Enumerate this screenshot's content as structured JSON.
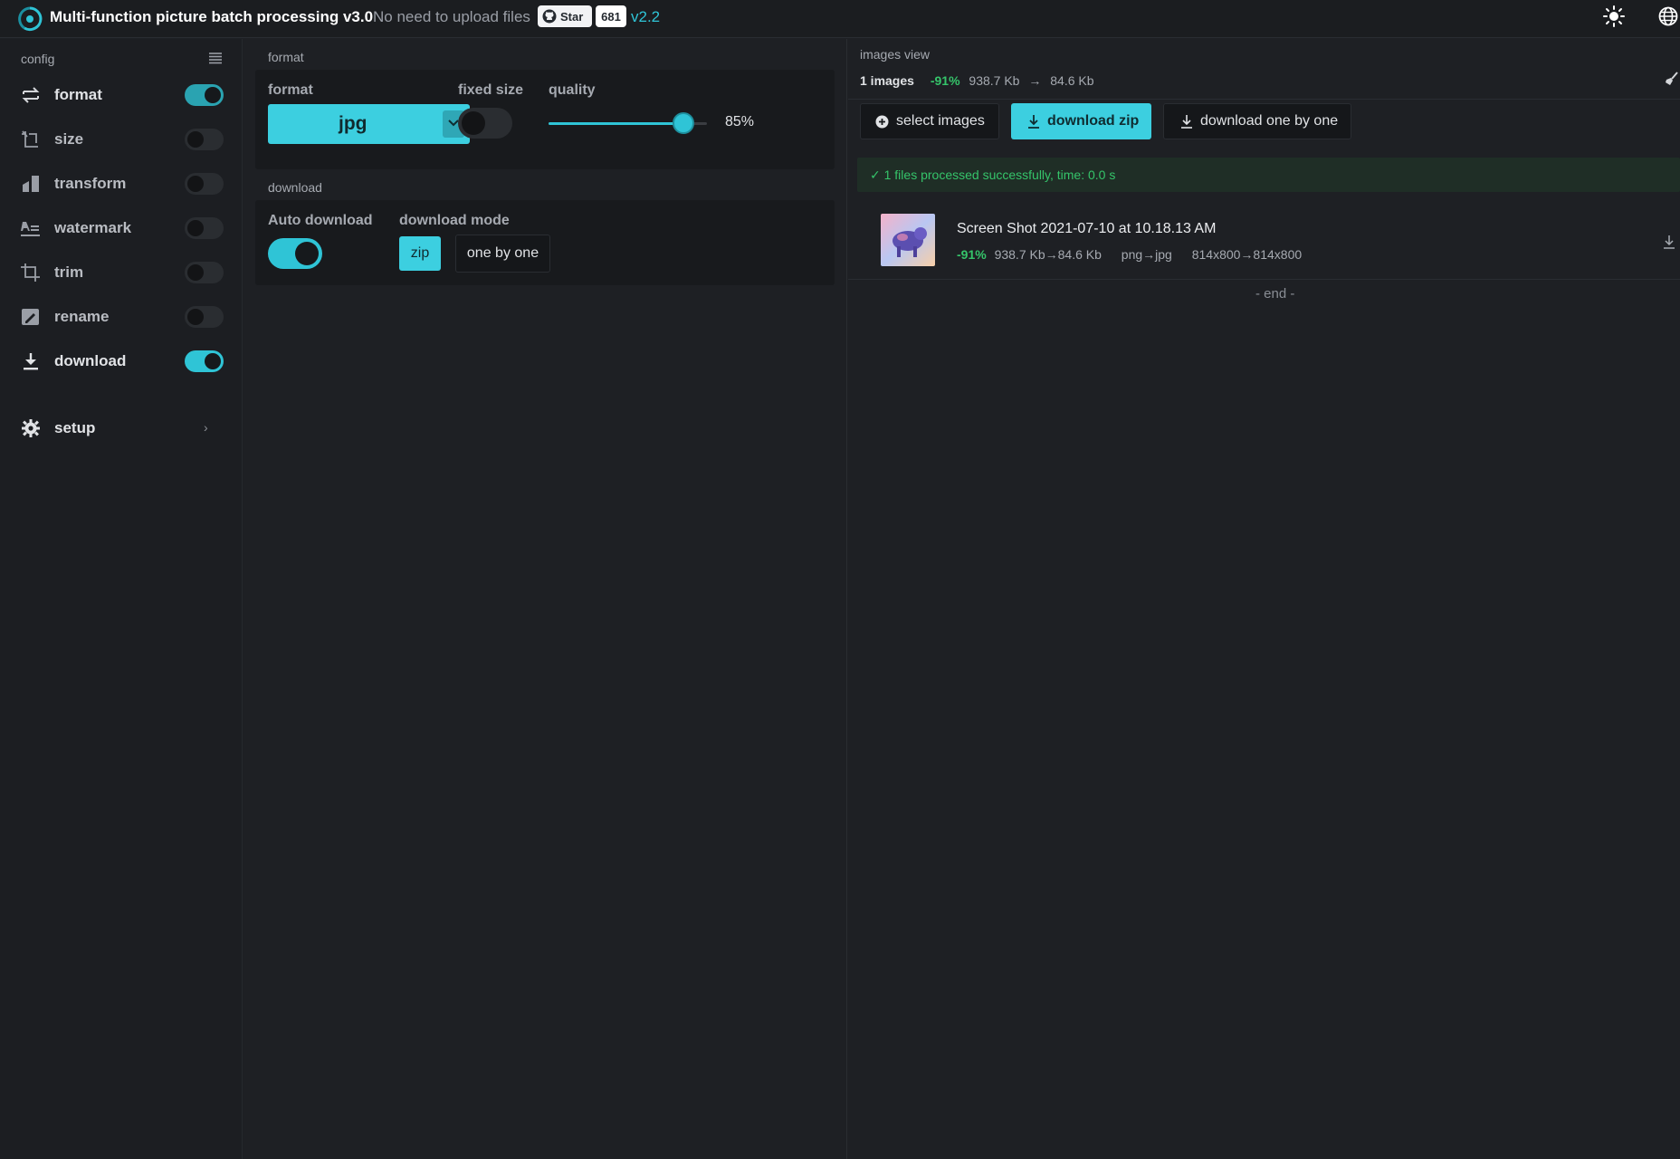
{
  "header": {
    "title": "Multi-function picture batch processing v3.0",
    "subtitle": "No need to upload files",
    "star_label": "Star",
    "star_count": "681",
    "version": "v2.2"
  },
  "sidebar": {
    "heading": "config",
    "items": [
      {
        "label": "format",
        "icon": "format-swap-icon",
        "enabled": true
      },
      {
        "label": "size",
        "icon": "resize-icon",
        "enabled": false
      },
      {
        "label": "transform",
        "icon": "transform-icon",
        "enabled": false
      },
      {
        "label": "watermark",
        "icon": "watermark-icon",
        "enabled": false
      },
      {
        "label": "trim",
        "icon": "crop-icon",
        "enabled": false
      },
      {
        "label": "rename",
        "icon": "rename-icon",
        "enabled": false
      },
      {
        "label": "download",
        "icon": "download-icon",
        "enabled": true
      }
    ],
    "setup_label": "setup"
  },
  "format_section": {
    "title": "format",
    "format_label": "format",
    "format_value": "jpg",
    "fixed_size_label": "fixed size",
    "fixed_size_enabled": false,
    "quality_label": "quality",
    "quality_value": "85%",
    "quality_fraction": 0.85
  },
  "download_section": {
    "title": "download",
    "auto_label": "Auto download",
    "auto_enabled": true,
    "mode_label": "download mode",
    "mode_zip": "zip",
    "mode_one": "one by one",
    "selected_mode": "zip"
  },
  "images_view": {
    "title": "images view",
    "count": "1 images",
    "percent": "-91%",
    "original_size": "938.7 Kb",
    "new_size": "84.6 Kb",
    "buttons": {
      "select": "select images",
      "zip": "download zip",
      "one": "download one by one"
    },
    "status": "✓  1 files processed successfully, time: 0.0 s",
    "files": [
      {
        "name": "Screen Shot 2021-07-10 at 10.18.13 AM",
        "percent": "-91%",
        "size": "938.7 Kb→84.6 Kb",
        "format": "png→jpg",
        "dims": "814x800→814x800"
      }
    ],
    "end_text": "- end -"
  },
  "colors": {
    "accent": "#3ccfe0",
    "success": "#35c46a",
    "background": "#1e2024"
  }
}
